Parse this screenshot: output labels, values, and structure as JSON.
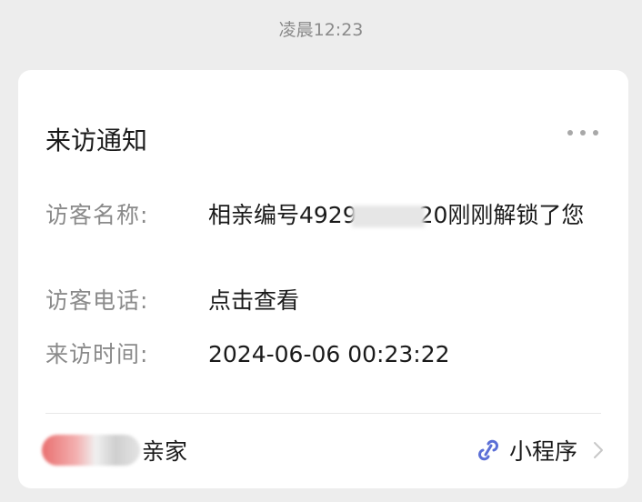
{
  "timestamp": "凌晨12:23",
  "card": {
    "title": "来访通知",
    "fields": [
      {
        "label": "访客名称:",
        "value_prefix": "相亲编号4929",
        "value_suffix": "20刚刚解锁了您"
      },
      {
        "label": "访客电话:",
        "value": "点击查看"
      },
      {
        "label": "来访时间:",
        "value": "2024-06-06 00:23:22"
      }
    ],
    "footer": {
      "source_name": "亲家",
      "mini_program_label": "小程序"
    }
  },
  "colors": {
    "background": "#ededed",
    "card": "#ffffff",
    "label": "#8a8a8a",
    "text": "#1a1a1a",
    "link_icon": "#5b6fd6"
  },
  "icons": [
    "more-icon",
    "link-icon",
    "chevron-right-icon"
  ]
}
